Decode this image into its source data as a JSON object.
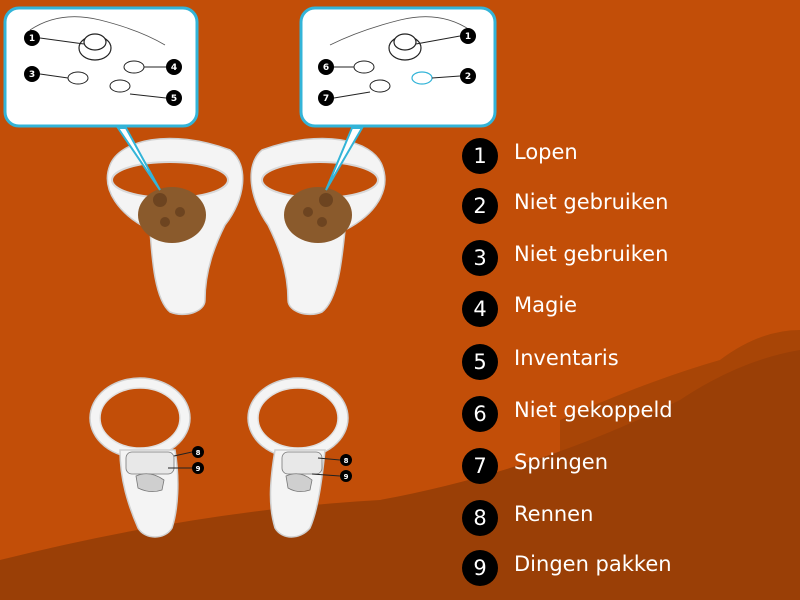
{
  "legend": [
    {
      "number": "1",
      "label": "Lopen"
    },
    {
      "number": "2",
      "label": "Niet gebruiken"
    },
    {
      "number": "3",
      "label": "Niet gebruiken"
    },
    {
      "number": "4",
      "label": "Magie"
    },
    {
      "number": "5",
      "label": "Inventaris"
    },
    {
      "number": "6",
      "label": "Niet gekoppeld"
    },
    {
      "number": "7",
      "label": "Springen"
    },
    {
      "number": "8",
      "label": "Rennen"
    },
    {
      "number": "9",
      "label": "Dingen pakken"
    }
  ],
  "callouts": {
    "left": [
      "1",
      "3",
      "4",
      "5"
    ],
    "right": [
      "1",
      "6",
      "2",
      "7"
    ],
    "back_left": [
      "8",
      "9"
    ],
    "back_right": [
      "8",
      "9"
    ]
  },
  "colors": {
    "background": "#c24e08",
    "hill_light": "#a84506",
    "hill_dark": "#9a3f06",
    "callout_fill": "#ffffff",
    "callout_border": "#33b4d8",
    "badge": "#000000",
    "controller": "#f4f4f4",
    "touchpad": "#8a5a2c"
  }
}
